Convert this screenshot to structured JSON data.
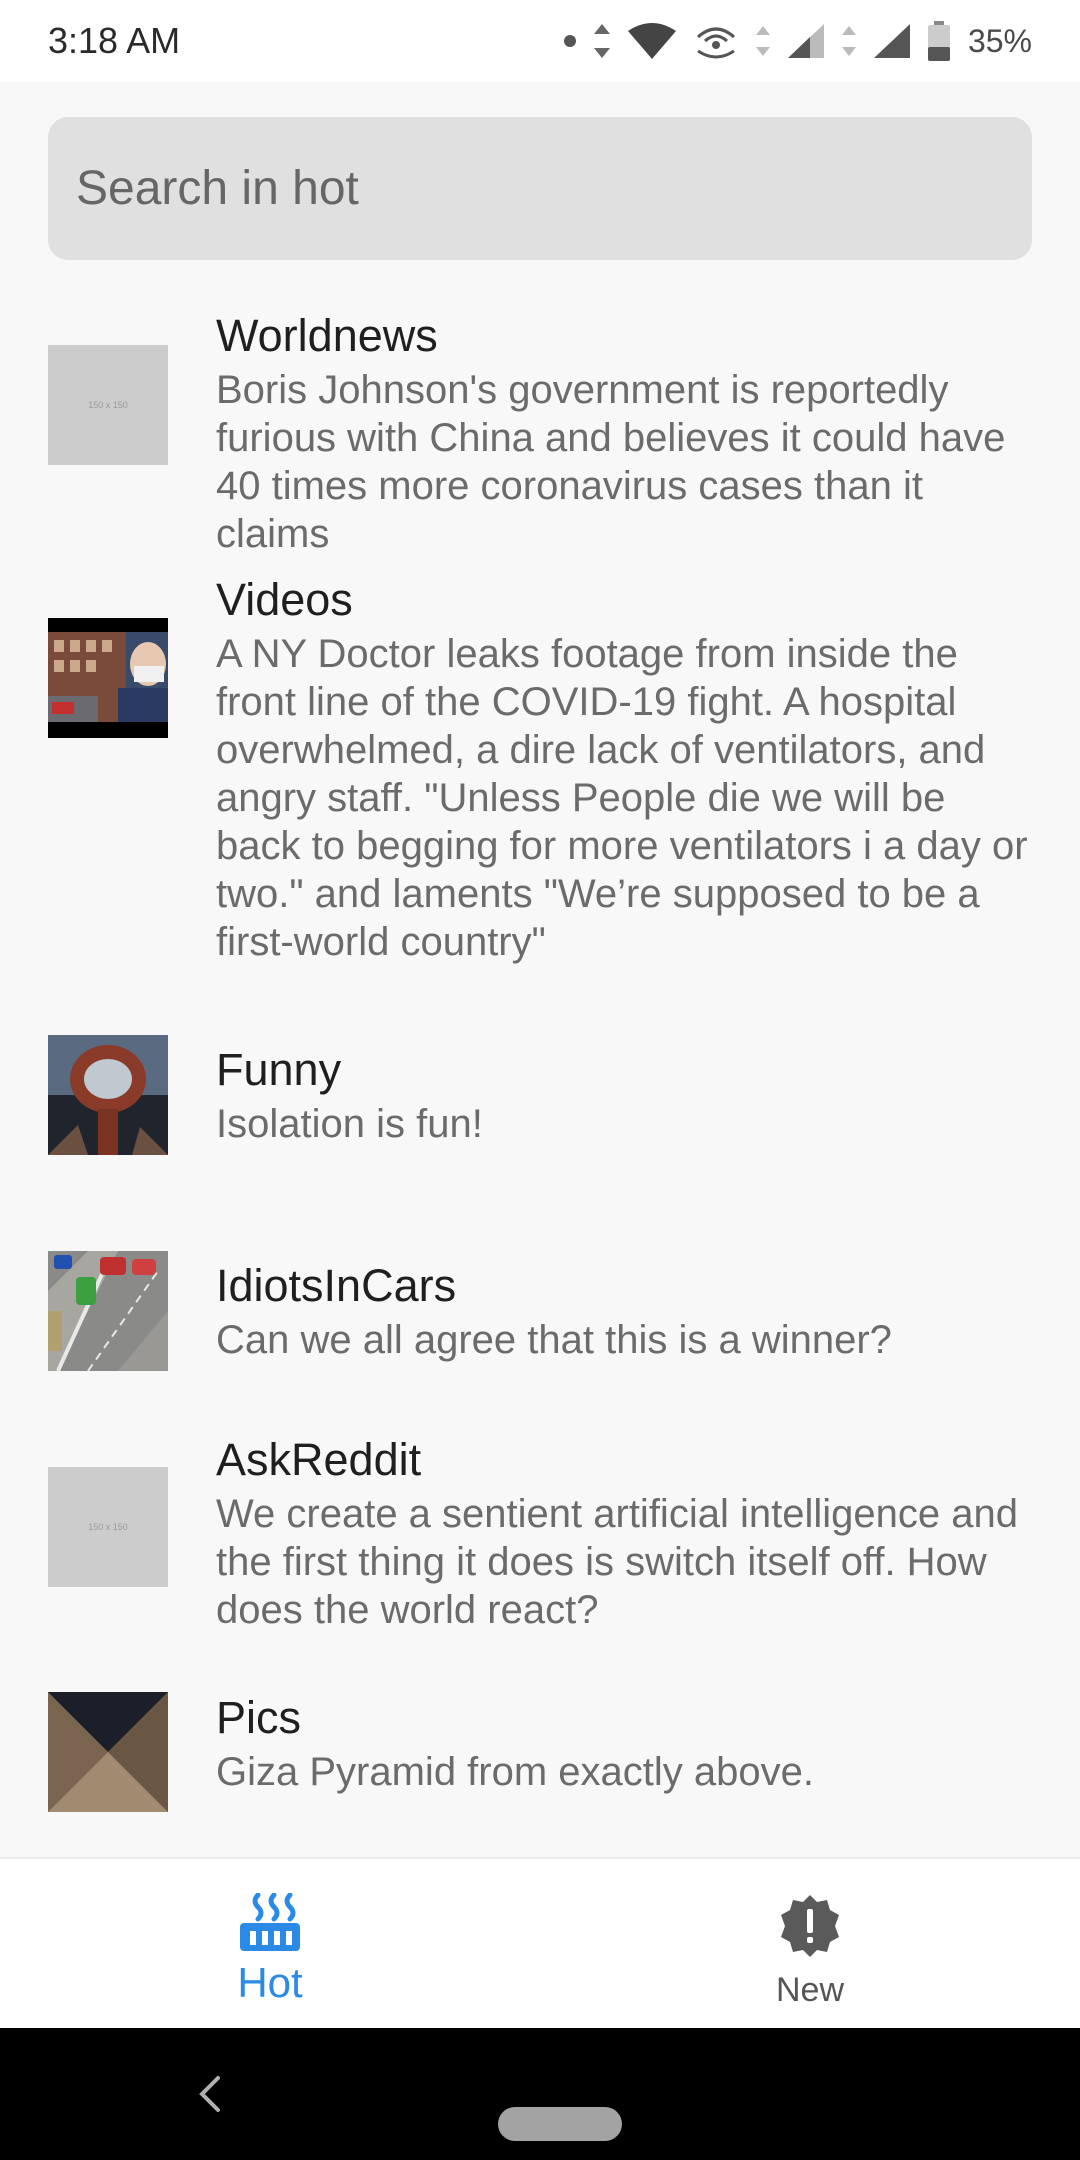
{
  "status_bar": {
    "time": "3:18 AM",
    "battery": "35%"
  },
  "search": {
    "placeholder": "Search in hot"
  },
  "posts": [
    {
      "subreddit": "Worldnews",
      "title": "Boris Johnson's government is reportedly furious with China and believes it could have 40 times more coronavirus cases than it claims",
      "thumbnail": "150 x 150"
    },
    {
      "subreddit": "Videos",
      "title": "A NY Doctor leaks footage from inside the front line of the COVID-19 fight. A hospital overwhelmed, a dire lack of ventilators, and angry staff. \"Unless People die we will be back to begging for more ventilators i a day or two.\" and laments \"We’re supposed to be a first-world country\""
    },
    {
      "subreddit": "Funny",
      "title": "Isolation is fun!"
    },
    {
      "subreddit": "IdiotsInCars",
      "title": "Can we all agree that this is a winner?"
    },
    {
      "subreddit": "AskReddit",
      "title": "We create a sentient artificial intelligence and the first thing it does is switch itself off. How does the world react?",
      "thumbnail": "150 x 150"
    },
    {
      "subreddit": "Pics",
      "title": "Giza Pyramid from exactly above."
    }
  ],
  "bottom_nav": {
    "hot_label": "Hot",
    "new_label": "New",
    "active_color": "#2a8ae5",
    "inactive_color": "#555555"
  }
}
